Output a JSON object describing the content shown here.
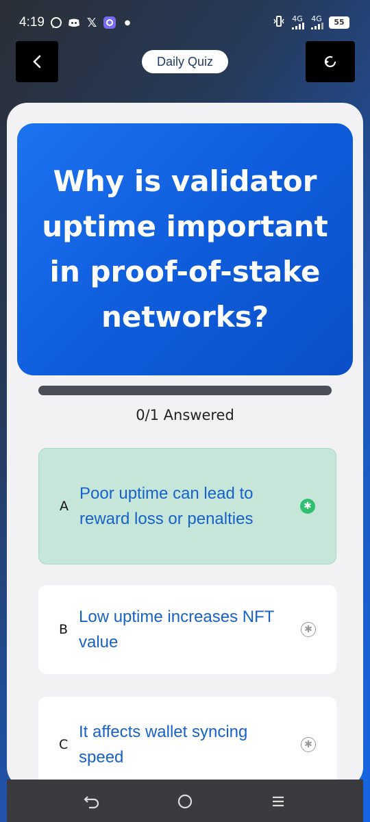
{
  "status_bar": {
    "time": "4:19",
    "network1": "4G",
    "network2": "4G",
    "battery": "55"
  },
  "header": {
    "title": "Daily Quiz"
  },
  "question": {
    "text": "Why is validator uptime important in proof-of-stake networks?"
  },
  "progress": {
    "answered_text": "0/1 Answered",
    "fraction": 0
  },
  "options": [
    {
      "letter": "A",
      "text": "Poor uptime can lead to reward loss or penalties",
      "selected": true
    },
    {
      "letter": "B",
      "text": "Low uptime increases NFT value",
      "selected": false
    },
    {
      "letter": "C",
      "text": "It affects wallet syncing speed",
      "selected": false
    }
  ],
  "colors": {
    "accent": "#0f5ddc",
    "selected_bg": "#c5e6d9",
    "option_text": "#1861c8"
  }
}
